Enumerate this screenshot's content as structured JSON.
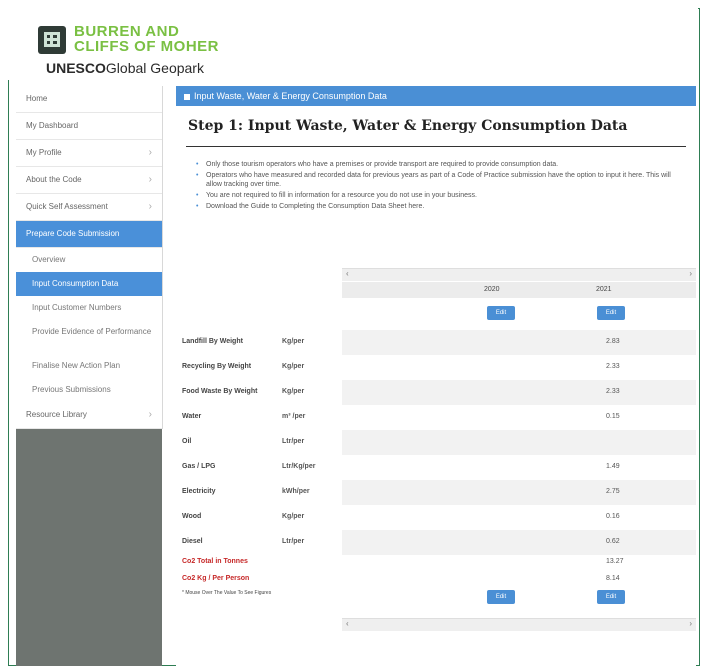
{
  "brand": {
    "line1": "BURREN AND",
    "line2": "CLIFFS OF MOHER",
    "line3a": "UNESCO",
    "line3b": "Global Geopark"
  },
  "sidebar": {
    "items": [
      {
        "label": "Home"
      },
      {
        "label": "My Dashboard"
      },
      {
        "label": "My Profile"
      },
      {
        "label": "About the Code"
      },
      {
        "label": "Quick Self Assessment"
      },
      {
        "label": "Prepare Code Submission"
      },
      {
        "label": "Resource Library"
      }
    ],
    "sub": [
      {
        "label": "Overview"
      },
      {
        "label": "Input Consumption Data"
      },
      {
        "label": "Input Customer Numbers"
      },
      {
        "label": "Provide Evidence of Performance"
      },
      {
        "label": "Finalise New Action Plan"
      },
      {
        "label": "Previous Submissions"
      }
    ]
  },
  "page": {
    "titlebar": "Input Waste, Water & Energy Consumption Data",
    "heading": "Step 1: Input Waste, Water & Energy Consumption Data",
    "notes": [
      "Only those tourism operators who have a premises or provide transport are required to provide consumption data.",
      "Operators who have measured and recorded data for previous years as part of a Code of Practice submission have the option to input it here. This will allow tracking over time.",
      "You are not required to fill in information for a resource you do not use in your business.",
      "Download the Guide to Completing the Consumption Data Sheet here."
    ]
  },
  "table": {
    "years": [
      "2020",
      "2021"
    ],
    "edit_label": "Edit",
    "rows": [
      {
        "label": "Landfill By Weight",
        "unit": "Kg/per",
        "v2021": "2.83"
      },
      {
        "label": "Recycling By Weight",
        "unit": "Kg/per",
        "v2021": "2.33"
      },
      {
        "label": "Food Waste By Weight",
        "unit": "Kg/per",
        "v2021": "2.33"
      },
      {
        "label": "Water",
        "unit": "m³ /per",
        "v2021": "0.15"
      },
      {
        "label": "Oil",
        "unit": "Ltr/per",
        "v2021": ""
      },
      {
        "label": "Gas / LPG",
        "unit": "Ltr/Kg/per",
        "v2021": "1.49"
      },
      {
        "label": "Electricity",
        "unit": "kWh/per",
        "v2021": "2.75"
      },
      {
        "label": "Wood",
        "unit": "Kg/per",
        "v2021": "0.16"
      },
      {
        "label": "Diesel",
        "unit": "Ltr/per",
        "v2021": "0.62"
      }
    ],
    "totals": [
      {
        "label": "Co2 Total in Tonnes",
        "v2021": "13.27"
      },
      {
        "label": "Co2 Kg / Per Person",
        "v2021": "8.14"
      }
    ],
    "footnote": "* Mouse Over The Value To See Figures"
  }
}
